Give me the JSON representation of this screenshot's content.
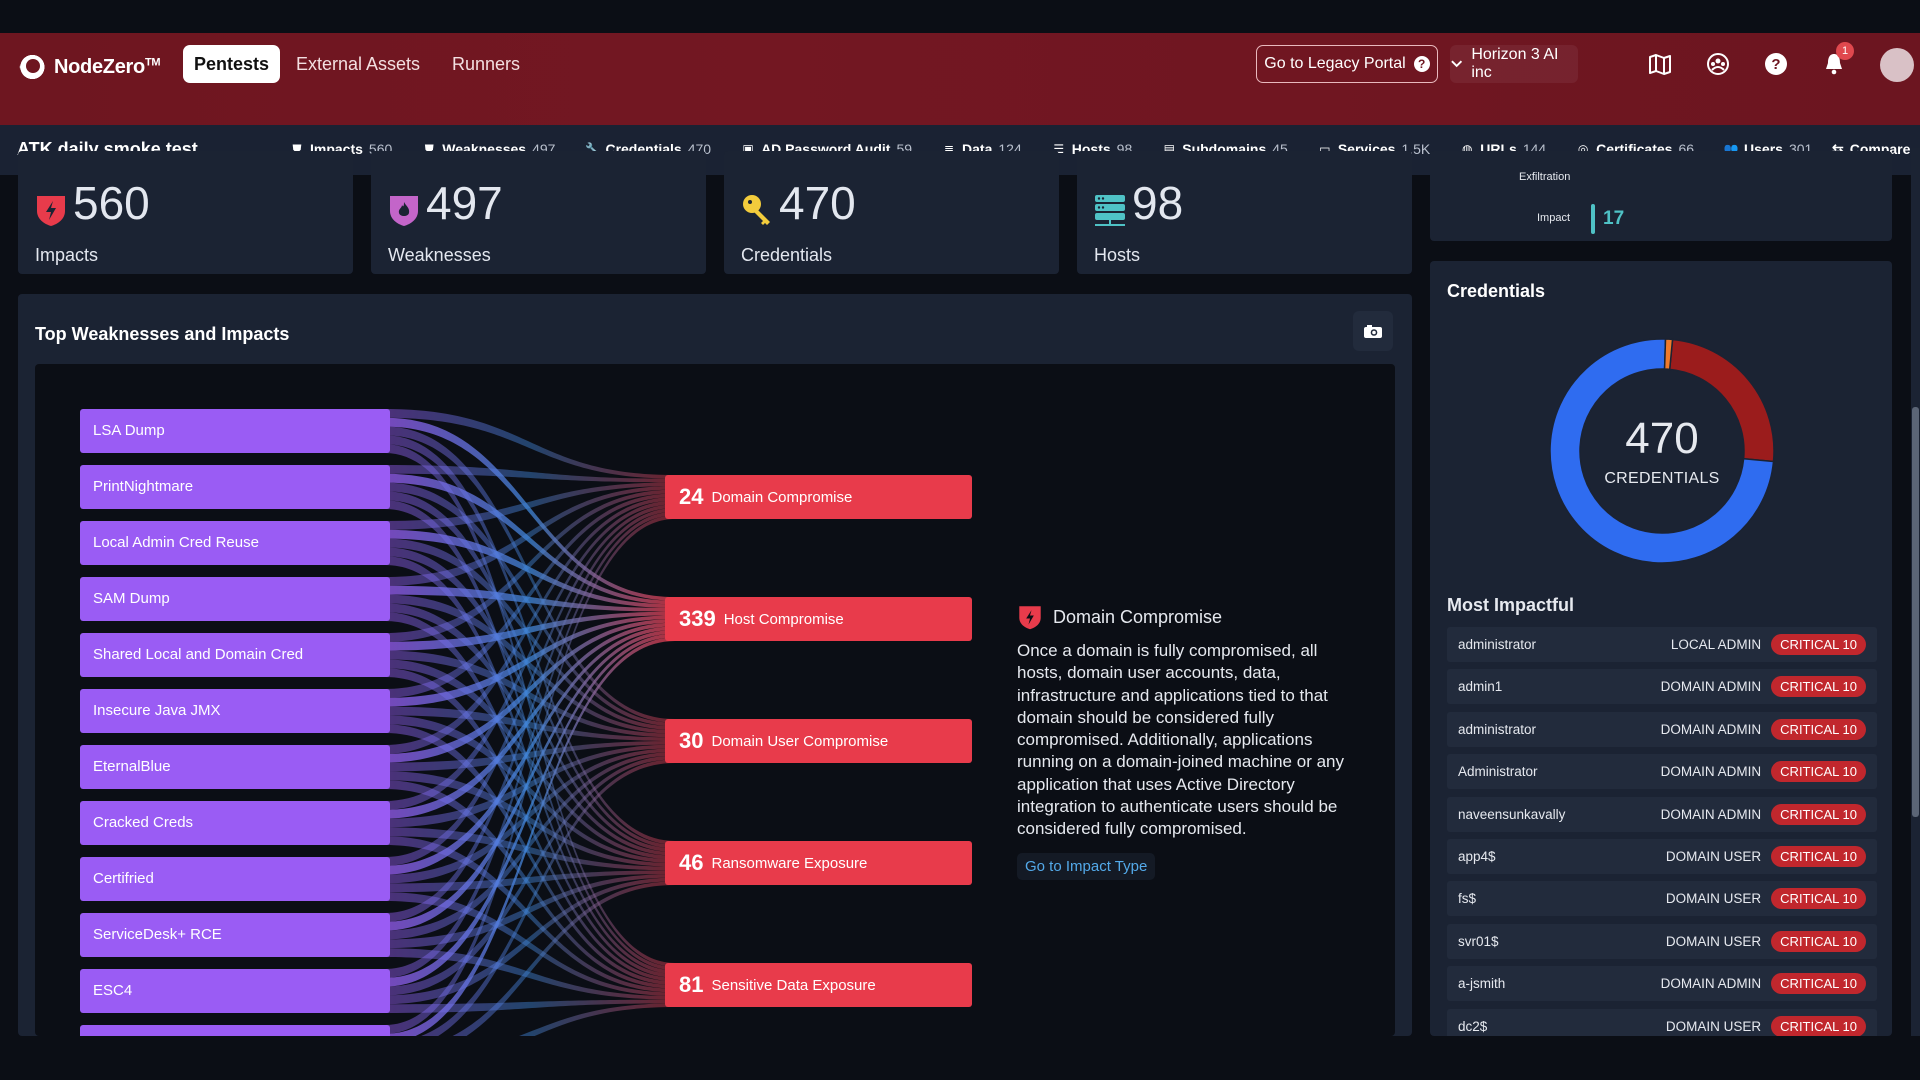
{
  "header": {
    "brand": "NodeZero",
    "brand_tm": "TM",
    "tabs": [
      {
        "label": "Pentests",
        "active": true
      },
      {
        "label": "External Assets",
        "active": false
      },
      {
        "label": "Runners",
        "active": false
      }
    ],
    "legacy_portal_label": "Go to Legacy Portal",
    "org_selector": "Horizon 3 AI inc",
    "notification_count": "1",
    "icons": [
      "map-icon",
      "community-icon",
      "help-icon",
      "bell-icon"
    ]
  },
  "subbar": {
    "title": "ATK daily smoke test",
    "stats": [
      {
        "icon": "shield-bolt-icon",
        "label": "Impacts",
        "value": "560"
      },
      {
        "icon": "shield-flame-icon",
        "label": "Weaknesses",
        "value": "497"
      },
      {
        "icon": "key-icon",
        "label": "Credentials",
        "value": "470"
      },
      {
        "icon": "ad-audit-icon",
        "label": "AD Password Audit",
        "value": "59"
      },
      {
        "icon": "database-icon",
        "label": "Data",
        "value": "124"
      },
      {
        "icon": "server-icon",
        "label": "Hosts",
        "value": "98"
      },
      {
        "icon": "subdomain-icon",
        "label": "Subdomains",
        "value": "45"
      },
      {
        "icon": "monitor-icon",
        "label": "Services",
        "value": "1.5K"
      },
      {
        "icon": "globe-icon",
        "label": "URLs",
        "value": "144"
      },
      {
        "icon": "certificate-icon",
        "label": "Certificates",
        "value": "66"
      },
      {
        "icon": "users-icon",
        "label": "Users",
        "value": "301"
      }
    ],
    "compare_label": "Compare"
  },
  "kpis": [
    {
      "value": "560",
      "label": "Impacts",
      "color": "#e83b4b"
    },
    {
      "value": "497",
      "label": "Weaknesses",
      "color": "#c365c9"
    },
    {
      "value": "470",
      "label": "Credentials",
      "color": "#f3cc3c"
    },
    {
      "value": "98",
      "label": "Hosts",
      "color": "#4fc2c6"
    }
  ],
  "attack_summary": {
    "exfiltration_label": "Exfiltration",
    "impact_label": "Impact",
    "impact_value": "17"
  },
  "sankey": {
    "title": "Top Weaknesses and Impacts",
    "weaknesses": [
      "LSA Dump",
      "PrintNightmare",
      "Local Admin Cred Reuse",
      "SAM Dump",
      "Shared Local and Domain Cred",
      "Insecure Java JMX",
      "EternalBlue",
      "Cracked Creds",
      "Certifried",
      "ServiceDesk+ RCE",
      "ESC4"
    ],
    "impacts": [
      {
        "count": "24",
        "label": "Domain Compromise"
      },
      {
        "count": "339",
        "label": "Host Compromise"
      },
      {
        "count": "30",
        "label": "Domain User Compromise"
      },
      {
        "count": "46",
        "label": "Ransomware Exposure"
      },
      {
        "count": "81",
        "label": "Sensitive Data Exposure"
      }
    ],
    "colors": {
      "weakness": "#9a5cf4",
      "impact": "#e83b4b",
      "flow_mid": "#3f86d8"
    }
  },
  "detail": {
    "title": "Domain Compromise",
    "description": "Once a domain is fully compromised, all hosts, domain user accounts, data, infrastructure and applications tied to that domain should be considered fully compromised. Additionally, applications running on a domain-joined machine or any application that uses Active Directory integration to authenticate users should be considered fully compromised.",
    "link_label": "Go to Impact Type"
  },
  "credentials_panel": {
    "title": "Credentials",
    "total": "470",
    "total_label": "CREDENTIALS",
    "most_impactful_title": "Most Impactful",
    "rows": [
      {
        "name": "administrator",
        "role": "LOCAL ADMIN",
        "severity": "CRITICAL 10"
      },
      {
        "name": "admin1",
        "role": "DOMAIN ADMIN",
        "severity": "CRITICAL 10"
      },
      {
        "name": "administrator",
        "role": "DOMAIN ADMIN",
        "severity": "CRITICAL 10"
      },
      {
        "name": "Administrator",
        "role": "DOMAIN ADMIN",
        "severity": "CRITICAL 10"
      },
      {
        "name": "naveensunkavally",
        "role": "DOMAIN ADMIN",
        "severity": "CRITICAL 10"
      },
      {
        "name": "app4$",
        "role": "DOMAIN USER",
        "severity": "CRITICAL 10"
      },
      {
        "name": "fs$",
        "role": "DOMAIN USER",
        "severity": "CRITICAL 10"
      },
      {
        "name": "svr01$",
        "role": "DOMAIN USER",
        "severity": "CRITICAL 10"
      },
      {
        "name": "a-jsmith",
        "role": "DOMAIN ADMIN",
        "severity": "CRITICAL 10"
      },
      {
        "name": "dc2$",
        "role": "DOMAIN USER",
        "severity": "CRITICAL 10"
      }
    ]
  },
  "chart_data": {
    "type": "pie",
    "title": "470 CREDENTIALS",
    "slices": [
      {
        "name": "critical",
        "value": 0.25,
        "color": "#9b1c1c"
      },
      {
        "name": "blue",
        "value": 0.74,
        "color": "#2f6cf0"
      },
      {
        "name": "orange",
        "value": 0.01,
        "color": "#f07a2b"
      }
    ],
    "total": 470
  }
}
